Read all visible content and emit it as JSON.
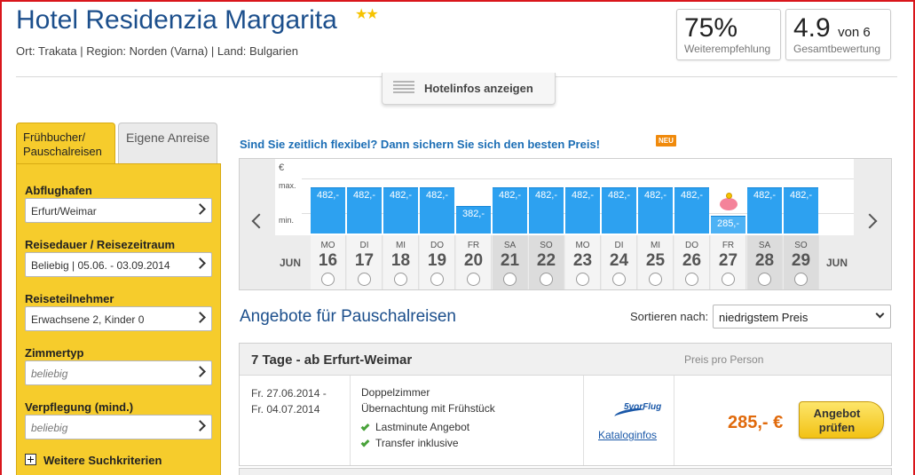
{
  "hotel": {
    "name": "Hotel Residenzia Margarita",
    "stars": "★★",
    "location": "Ort: Trakata | Region: Norden (Varna) | Land: Bulgarien"
  },
  "scores": {
    "recommend_value": "75%",
    "recommend_label": "Weiterempfehlung",
    "rating_value": "4.9",
    "rating_unit": "von 6",
    "rating_label": "Gesamtbewertung"
  },
  "hotelinfo_button": "Hotelinfos anzeigen",
  "tabs": {
    "active": "Frühbucher/ Pauschalreisen",
    "other": "Eigene Anreise"
  },
  "filters": [
    {
      "label": "Abflughafen",
      "value": "Erfurt/Weimar",
      "placeholder": false
    },
    {
      "label": "Reisedauer / Reisezeitraum",
      "value": "Beliebig | 05.06. - 03.09.2014",
      "placeholder": false
    },
    {
      "label": "Reiseteilnehmer",
      "value": "Erwachsene 2, Kinder 0",
      "placeholder": false
    },
    {
      "label": "Zimmertyp",
      "value": "beliebig",
      "placeholder": true
    },
    {
      "label": "Verpflegung (mind.)",
      "value": "beliebig",
      "placeholder": true
    }
  ],
  "more_criteria": "Weitere Suchkriterien",
  "flex": {
    "question": "Sind Sie zeitlich flexibel? Dann sichern Sie sich den besten Preis!",
    "badge": "NEU"
  },
  "calendar": {
    "currency": "€",
    "max_label": "max.",
    "min_label": "min.",
    "month_left": "JUN",
    "month_right": "JUN",
    "days": [
      {
        "wd": "MO",
        "d": "16",
        "price": 482,
        "label": "482,-",
        "weekend": false
      },
      {
        "wd": "DI",
        "d": "17",
        "price": 482,
        "label": "482,-",
        "weekend": false
      },
      {
        "wd": "MI",
        "d": "18",
        "price": 482,
        "label": "482,-",
        "weekend": false
      },
      {
        "wd": "DO",
        "d": "19",
        "price": 482,
        "label": "482,-",
        "weekend": false
      },
      {
        "wd": "FR",
        "d": "20",
        "price": 382,
        "label": "382,-",
        "weekend": false
      },
      {
        "wd": "SA",
        "d": "21",
        "price": 482,
        "label": "482,-",
        "weekend": true
      },
      {
        "wd": "SO",
        "d": "22",
        "price": 482,
        "label": "482,-",
        "weekend": true
      },
      {
        "wd": "MO",
        "d": "23",
        "price": 482,
        "label": "482,-",
        "weekend": false
      },
      {
        "wd": "DI",
        "d": "24",
        "price": 482,
        "label": "482,-",
        "weekend": false
      },
      {
        "wd": "MI",
        "d": "25",
        "price": 482,
        "label": "482,-",
        "weekend": false
      },
      {
        "wd": "DO",
        "d": "26",
        "price": 482,
        "label": "482,-",
        "weekend": false
      },
      {
        "wd": "FR",
        "d": "27",
        "price": 285,
        "label": "285,-",
        "weekend": false,
        "cheapest": true
      },
      {
        "wd": "SA",
        "d": "28",
        "price": 482,
        "label": "482,-",
        "weekend": true
      },
      {
        "wd": "SO",
        "d": "29",
        "price": 482,
        "label": "482,-",
        "weekend": true
      }
    ]
  },
  "offers": {
    "title": "Angebote für Pauschalreisen",
    "sort_label": "Sortieren nach:",
    "sort_value": "niedrigstem Preis",
    "items": [
      {
        "heading": "7 Tage - ab Erfurt-Weimar",
        "price_per": "Preis pro Person",
        "date_from": "Fr. 27.06.2014 -",
        "date_to": "Fr. 04.07.2014",
        "room": "Doppelzimmer",
        "board": "Übernachtung mit Frühstück",
        "features": [
          "Lastminute Angebot",
          "Transfer inklusive"
        ],
        "operator_logo": "5vorFlug",
        "catalog_link": "Kataloginfos",
        "price": "285,- €",
        "book_label": "Angebot prüfen"
      }
    ]
  },
  "colors": {
    "brand_blue": "#1c4f8c",
    "sidebar_yellow": "#f6cc2c",
    "bar_blue": "#2da1f0",
    "price_orange": "#e06a0c",
    "frame_red": "#d9161c"
  }
}
